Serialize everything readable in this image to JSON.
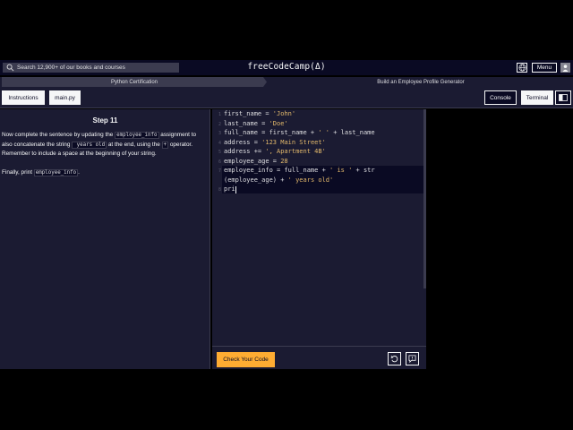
{
  "header": {
    "search_placeholder": "Search 12,900+ of our books and courses",
    "brand": "freeCodeCamp(Δ)",
    "menu_label": "Menu",
    "icons": {
      "search": "search-icon",
      "globe": "globe-icon",
      "avatar": "avatar-icon"
    }
  },
  "breadcrumb": {
    "certification": "Python Certification",
    "project": "Build an Employee Profile Generator"
  },
  "tabs": {
    "instructions": "Instructions",
    "file": "main.py",
    "console": "Console",
    "terminal": "Terminal"
  },
  "instructions": {
    "step_title": "Step 11",
    "p1_a": "Now complete the sentence by updating the ",
    "p1_code1": "employee_info",
    "p1_b": " assignment to also concatenate the string ",
    "p1_code2": " years old",
    "p1_c": " at the end, using the ",
    "p1_code3": "+",
    "p1_d": " operator. Remember to include a space at the beginning of your string.",
    "p2_a": "Finally, print ",
    "p2_code": "employee_info",
    "p2_b": "."
  },
  "editor": {
    "line_numbers": [
      "1",
      "2",
      "3",
      "4",
      "5",
      "6",
      "7",
      "",
      "8"
    ],
    "lines": {
      "l1_a": "first_name = ",
      "l1_s": "'John'",
      "l2_a": "last_name = ",
      "l2_s": "'Doe'",
      "l3_a": "full_name = first_name + ",
      "l3_s": "' '",
      "l3_b": " + last_name",
      "l4_a": "address = ",
      "l4_s": "'123 Main Street'",
      "l5_a": "address += ",
      "l5_s": "', Apartment 4B'",
      "l6_a": "employee_age = ",
      "l6_n": "28",
      "l7_a": "employee_info = full_name + ",
      "l7_s": "' is '",
      "l7_b": " + str",
      "l7w_a": "(employee_age) + ",
      "l7w_s": "' years old'",
      "l8_a": "pri"
    }
  },
  "actions": {
    "check_label": "Check Your Code",
    "icons": {
      "reset": "reset-icon",
      "help": "help-icon"
    }
  },
  "colors": {
    "bg_dark": "#0a0a23",
    "panel": "#1b1b32",
    "accent": "#feac32",
    "string": "#e2b86b"
  }
}
